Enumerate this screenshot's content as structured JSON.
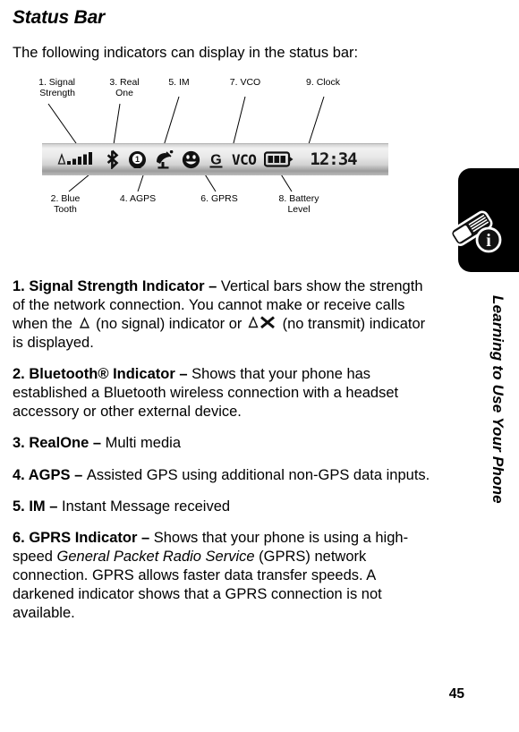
{
  "page": {
    "title": "Status Bar",
    "intro": "The following indicators can display in the status bar:",
    "number": "45",
    "side_title": "Learning to Use Your Phone",
    "margin_tab_icon": "phone-info-icon"
  },
  "diagram": {
    "name": "status-bar-callout-diagram",
    "top_labels": [
      {
        "id": "signal-strength",
        "text": "1. Signal\nStrength"
      },
      {
        "id": "real-one",
        "text": "3. Real\nOne"
      },
      {
        "id": "im",
        "text": "5. IM"
      },
      {
        "id": "vco",
        "text": "7. VCO"
      },
      {
        "id": "clock",
        "text": "9. Clock"
      }
    ],
    "bottom_labels": [
      {
        "id": "bluetooth",
        "text": "2. Blue\nTooth"
      },
      {
        "id": "agps",
        "text": "4. AGPS"
      },
      {
        "id": "gprs",
        "text": "6. GPRS"
      },
      {
        "id": "battery-level",
        "text": "8. Battery\nLevel"
      }
    ],
    "statusbar_icons": [
      {
        "id": "signal-strength-icon",
        "label": "signal strength bars"
      },
      {
        "id": "bluetooth-icon",
        "label": "bluetooth"
      },
      {
        "id": "realone-icon",
        "label": "RealOne"
      },
      {
        "id": "agps-icon",
        "label": "AGPS satellite dish"
      },
      {
        "id": "im-icon",
        "label": "instant message smiley"
      },
      {
        "id": "gprs-icon",
        "label": "GPRS letter G"
      },
      {
        "id": "vco-icon",
        "label": "VCO"
      },
      {
        "id": "battery-icon",
        "label": "battery level"
      }
    ],
    "vco_text": "VCO",
    "gprs_letter": "G",
    "clock_text": "12:34"
  },
  "items": [
    {
      "id": "signal-strength-indicator",
      "lead": "1. Signal Strength Indicator – ",
      "body_1": "Vertical bars show the strength of the network connection. You cannot make or receive calls when the ",
      "body_2": " (no signal) indicator or ",
      "body_3": " (no transmit) indicator is displayed.",
      "icon_1": "no-signal-icon",
      "icon_2": "no-transmit-icon"
    },
    {
      "id": "bluetooth-indicator",
      "lead": "2. Bluetooth® Indicator – ",
      "body": "Shows that your phone has established a Bluetooth wireless connection with a headset accessory or other external device."
    },
    {
      "id": "realone",
      "lead": "3. RealOne – ",
      "body": "Multi media"
    },
    {
      "id": "agps",
      "lead": "4. AGPS – ",
      "body": "Assisted GPS using additional non-GPS data inputs."
    },
    {
      "id": "im",
      "lead": "5. IM – ",
      "body": "Instant Message received"
    },
    {
      "id": "gprs-indicator",
      "lead": "6. GPRS Indicator – ",
      "body_1": "Shows that your phone is using a high-speed ",
      "body_italic": "General Packet Radio Service",
      "body_2": " (GPRS) network connection. GPRS allows faster data transfer speeds. A darkened indicator shows that a GPRS connection is not available."
    }
  ]
}
